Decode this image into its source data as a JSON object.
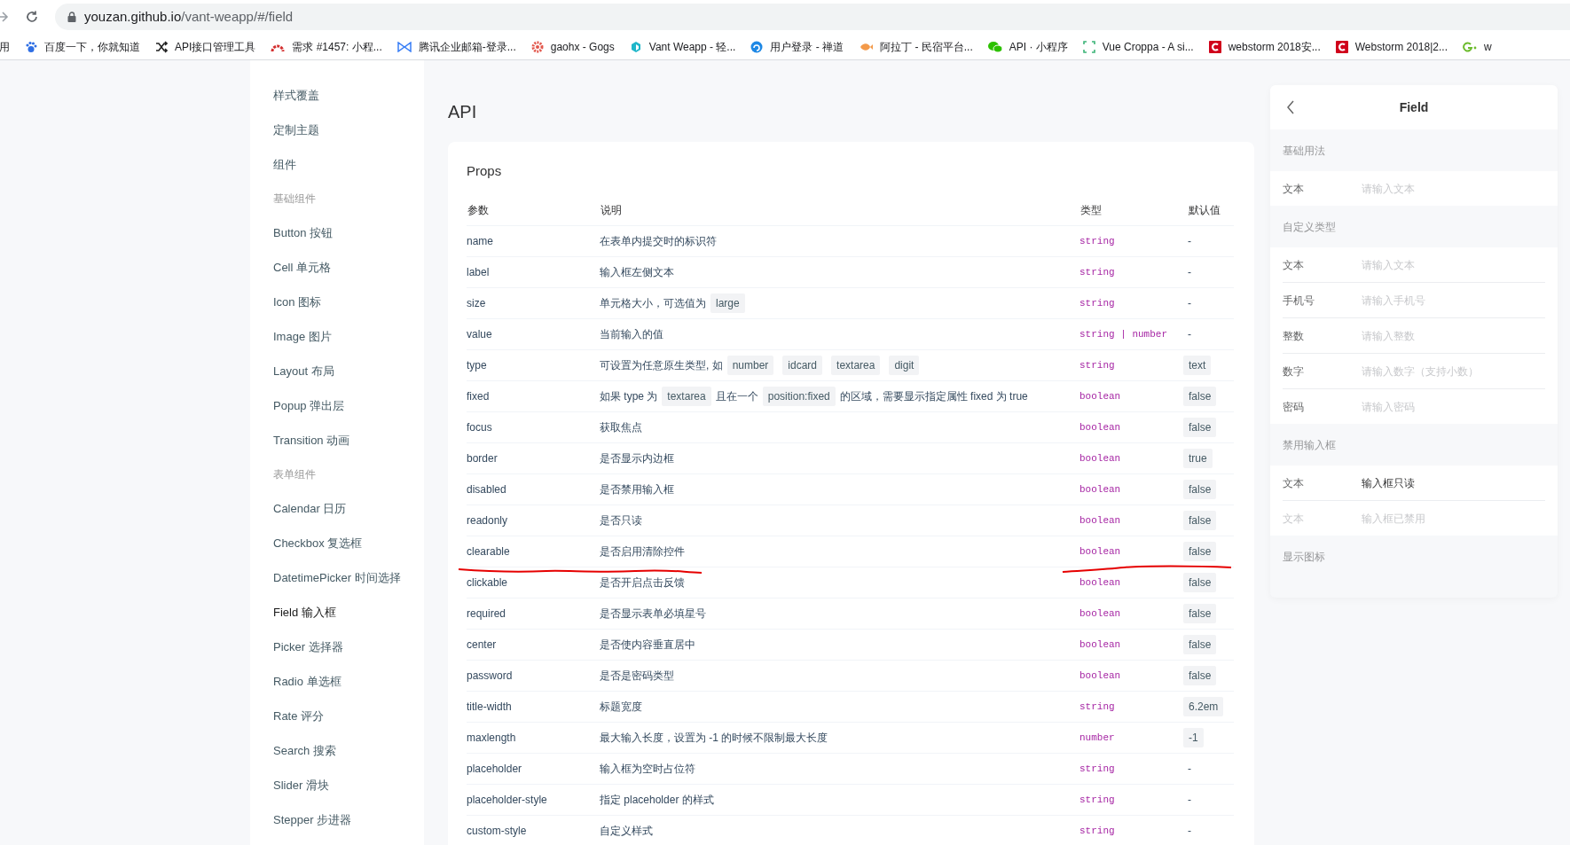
{
  "browser": {
    "url_host": "youzan.github.io",
    "url_path": "/vant-weapp/#/field",
    "bookmarks": [
      {
        "label": "用",
        "kind": "none"
      },
      {
        "label": "百度一下，你就知道",
        "kind": "paw"
      },
      {
        "label": "API接口管理工具",
        "kind": "shuffle"
      },
      {
        "label": "需求 #1457: 小程...",
        "kind": "arc"
      },
      {
        "label": "腾讯企业邮箱-登录...",
        "kind": "mail"
      },
      {
        "label": "gaohx - Gogs",
        "kind": "gear"
      },
      {
        "label": "Vant Weapp - 轻...",
        "kind": "hex"
      },
      {
        "label": "用户登录 - 禅道",
        "kind": "swirl"
      },
      {
        "label": "阿拉丁 - 民宿平台...",
        "kind": "fish"
      },
      {
        "label": "API · 小程序",
        "kind": "chat"
      },
      {
        "label": "Vue Croppa - A si...",
        "kind": "crop"
      },
      {
        "label": "webstorm 2018安...",
        "kind": "letter"
      },
      {
        "label": "Webstorm 2018|2...",
        "kind": "letter"
      },
      {
        "label": "w",
        "kind": "g"
      }
    ]
  },
  "sidebar": {
    "items": [
      {
        "label": "样式覆盖",
        "kind": "link",
        "selected": false
      },
      {
        "label": "定制主题",
        "kind": "link",
        "selected": false
      },
      {
        "label": "组件",
        "kind": "link",
        "selected": false
      },
      {
        "label": "基础组件",
        "kind": "group"
      },
      {
        "label": "Button 按钮",
        "kind": "link",
        "selected": false
      },
      {
        "label": "Cell 单元格",
        "kind": "link",
        "selected": false
      },
      {
        "label": "Icon 图标",
        "kind": "link",
        "selected": false
      },
      {
        "label": "Image 图片",
        "kind": "link",
        "selected": false
      },
      {
        "label": "Layout 布局",
        "kind": "link",
        "selected": false
      },
      {
        "label": "Popup 弹出层",
        "kind": "link",
        "selected": false
      },
      {
        "label": "Transition 动画",
        "kind": "link",
        "selected": false
      },
      {
        "label": "表单组件",
        "kind": "group"
      },
      {
        "label": "Calendar 日历",
        "kind": "link",
        "selected": false
      },
      {
        "label": "Checkbox 复选框",
        "kind": "link",
        "selected": false
      },
      {
        "label": "DatetimePicker 时间选择",
        "kind": "link",
        "selected": false
      },
      {
        "label": "Field 输入框",
        "kind": "link",
        "selected": true
      },
      {
        "label": "Picker 选择器",
        "kind": "link",
        "selected": false
      },
      {
        "label": "Radio 单选框",
        "kind": "link",
        "selected": false
      },
      {
        "label": "Rate 评分",
        "kind": "link",
        "selected": false
      },
      {
        "label": "Search 搜索",
        "kind": "link",
        "selected": false
      },
      {
        "label": "Slider 滑块",
        "kind": "link",
        "selected": false
      },
      {
        "label": "Stepper 步进器",
        "kind": "link",
        "selected": false
      }
    ]
  },
  "content": {
    "heading": "API",
    "card_title": "Props",
    "table": {
      "columns": [
        "参数",
        "说明",
        "类型",
        "默认值"
      ],
      "rows": [
        {
          "param": "name",
          "description": [
            {
              "kind": "text",
              "text": "在表单内提交时的标识符"
            }
          ],
          "type": "string",
          "default": {
            "kind": "text",
            "text": "-"
          },
          "underlined": false
        },
        {
          "param": "label",
          "description": [
            {
              "kind": "text",
              "text": "输入框左侧文本"
            }
          ],
          "type": "string",
          "default": {
            "kind": "text",
            "text": "-"
          },
          "underlined": false
        },
        {
          "param": "size",
          "description": [
            {
              "kind": "text",
              "text": "单元格大小，可选值为"
            },
            {
              "kind": "code",
              "text": "large"
            }
          ],
          "type": "string",
          "default": {
            "kind": "text",
            "text": "-"
          },
          "underlined": false
        },
        {
          "param": "value",
          "description": [
            {
              "kind": "text",
              "text": "当前输入的值"
            }
          ],
          "type": "string | number",
          "default": {
            "kind": "text",
            "text": "-"
          },
          "underlined": false
        },
        {
          "param": "type",
          "description": [
            {
              "kind": "text",
              "text": "可设置为任意原生类型, 如"
            },
            {
              "kind": "code",
              "text": "number"
            },
            {
              "kind": "code",
              "text": "idcard"
            },
            {
              "kind": "code",
              "text": "textarea"
            },
            {
              "kind": "code",
              "text": "digit"
            }
          ],
          "type": "string",
          "default": {
            "kind": "code",
            "text": "text"
          },
          "underlined": false
        },
        {
          "param": "fixed",
          "description": [
            {
              "kind": "text",
              "text": "如果 type 为"
            },
            {
              "kind": "code",
              "text": "textarea"
            },
            {
              "kind": "text",
              "text": "且在一个"
            },
            {
              "kind": "code",
              "text": "position:fixed"
            },
            {
              "kind": "text",
              "text": "的区域，需要显示指定属性 fixed 为 true"
            }
          ],
          "type": "boolean",
          "default": {
            "kind": "code",
            "text": "false"
          },
          "underlined": false
        },
        {
          "param": "focus",
          "description": [
            {
              "kind": "text",
              "text": "获取焦点"
            }
          ],
          "type": "boolean",
          "default": {
            "kind": "code",
            "text": "false"
          },
          "underlined": false
        },
        {
          "param": "border",
          "description": [
            {
              "kind": "text",
              "text": "是否显示内边框"
            }
          ],
          "type": "boolean",
          "default": {
            "kind": "code",
            "text": "true"
          },
          "underlined": false
        },
        {
          "param": "disabled",
          "description": [
            {
              "kind": "text",
              "text": "是否禁用输入框"
            }
          ],
          "type": "boolean",
          "default": {
            "kind": "code",
            "text": "false"
          },
          "underlined": false
        },
        {
          "param": "readonly",
          "description": [
            {
              "kind": "text",
              "text": "是否只读"
            }
          ],
          "type": "boolean",
          "default": {
            "kind": "code",
            "text": "false"
          },
          "underlined": false
        },
        {
          "param": "clearable",
          "description": [
            {
              "kind": "text",
              "text": "是否启用清除控件"
            }
          ],
          "type": "boolean",
          "default": {
            "kind": "code",
            "text": "false"
          },
          "underlined": true
        },
        {
          "param": "clickable",
          "description": [
            {
              "kind": "text",
              "text": "是否开启点击反馈"
            }
          ],
          "type": "boolean",
          "default": {
            "kind": "code",
            "text": "false"
          },
          "underlined": false
        },
        {
          "param": "required",
          "description": [
            {
              "kind": "text",
              "text": "是否显示表单必填星号"
            }
          ],
          "type": "boolean",
          "default": {
            "kind": "code",
            "text": "false"
          },
          "underlined": false
        },
        {
          "param": "center",
          "description": [
            {
              "kind": "text",
              "text": "是否使内容垂直居中"
            }
          ],
          "type": "boolean",
          "default": {
            "kind": "code",
            "text": "false"
          },
          "underlined": false
        },
        {
          "param": "password",
          "description": [
            {
              "kind": "text",
              "text": "是否是密码类型"
            }
          ],
          "type": "boolean",
          "default": {
            "kind": "code",
            "text": "false"
          },
          "underlined": false
        },
        {
          "param": "title-width",
          "description": [
            {
              "kind": "text",
              "text": "标题宽度"
            }
          ],
          "type": "string",
          "default": {
            "kind": "code",
            "text": "6.2em"
          },
          "underlined": false
        },
        {
          "param": "maxlength",
          "description": [
            {
              "kind": "text",
              "text": "最大输入长度，设置为 -1 的时候不限制最大长度"
            }
          ],
          "type": "number",
          "default": {
            "kind": "code",
            "text": "-1"
          },
          "underlined": false
        },
        {
          "param": "placeholder",
          "description": [
            {
              "kind": "text",
              "text": "输入框为空时占位符"
            }
          ],
          "type": "string",
          "default": {
            "kind": "text",
            "text": "-"
          },
          "underlined": false
        },
        {
          "param": "placeholder-style",
          "description": [
            {
              "kind": "text",
              "text": "指定 placeholder 的样式"
            }
          ],
          "type": "string",
          "default": {
            "kind": "text",
            "text": "-"
          },
          "underlined": false
        },
        {
          "param": "custom-style",
          "description": [
            {
              "kind": "text",
              "text": "自定义样式"
            }
          ],
          "type": "string",
          "default": {
            "kind": "text",
            "text": "-"
          },
          "underlined": false
        }
      ]
    }
  },
  "preview": {
    "title": "Field",
    "sections": [
      {
        "title": "基础用法",
        "cells": [
          {
            "label": "文本",
            "placeholder": "请输入文本",
            "disabled": false
          }
        ]
      },
      {
        "title": "自定义类型",
        "cells": [
          {
            "label": "文本",
            "placeholder": "请输入文本",
            "disabled": false
          },
          {
            "label": "手机号",
            "placeholder": "请输入手机号",
            "disabled": false
          },
          {
            "label": "整数",
            "placeholder": "请输入整数",
            "disabled": false
          },
          {
            "label": "数字",
            "placeholder": "请输入数字（支持小数）",
            "disabled": false
          },
          {
            "label": "密码",
            "placeholder": "请输入密码",
            "disabled": false
          }
        ]
      },
      {
        "title": "禁用输入框",
        "cells": [
          {
            "label": "文本",
            "value": "输入框只读",
            "disabled": false
          },
          {
            "label": "文本",
            "value": "输入框已禁用",
            "disabled": true
          }
        ]
      },
      {
        "title": "显示图标"
      }
    ]
  }
}
